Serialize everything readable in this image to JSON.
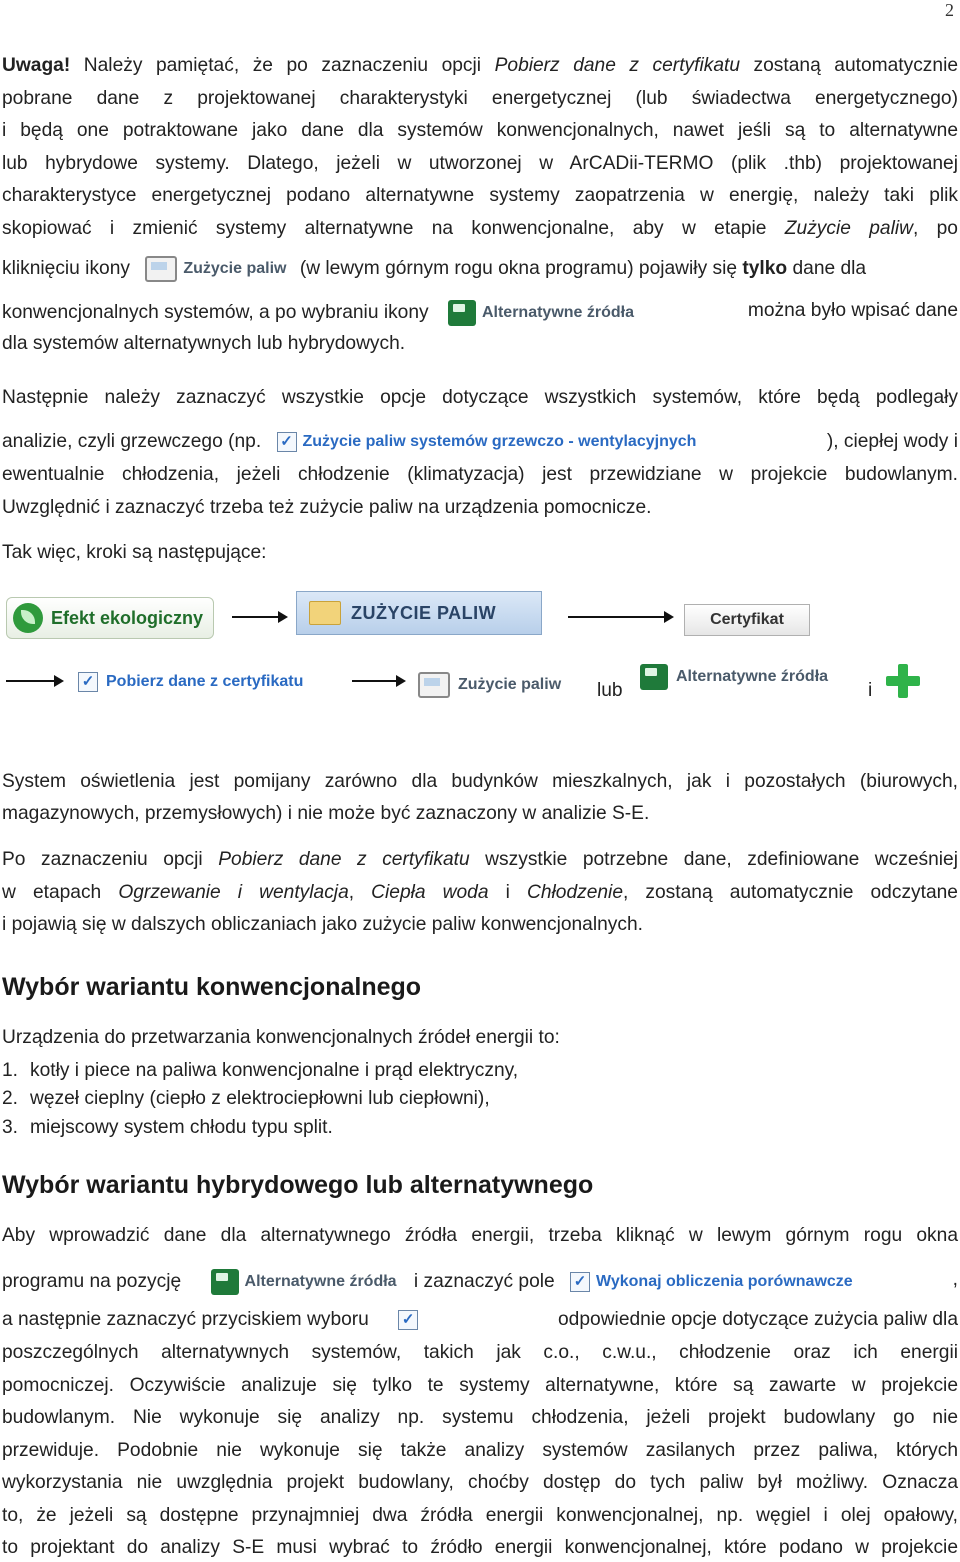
{
  "page_number": "2",
  "note": {
    "lead": "Uwaga!",
    "lines": [
      " Należy pamiętać, że po zaznaczeniu opcji ",
      "Pobierz dane z certyfikatu",
      " zostaną automatycznie"
    ],
    "l2": "pobrane dane z projektowanej charakterystyki energetycznej (lub świadectwa energetycznego)",
    "l3": "i będą one potraktowane jako dane dla systemów konwencjonalnych, nawet jeśli są to alternatywne",
    "l4": "lub hybrydowe systemy. Dlatego, jeżeli w utworzonej w ArCADii-TERMO (plik .thb) projektowanej",
    "l5": "charakterystyce energetycznej podano alternatywne systemy zaopatrzenia w energię, należy taki plik",
    "l6a": "skopiować i zmienić systemy alternatywne na konwencjonalne, aby w etapie ",
    "l6b": "Zużycie paliw",
    "l6c": ", po",
    "l7a": "kliknięciu ikony",
    "l7b": "(w lewym górnym rogu okna programu) pojawiły się ",
    "l7c": "tylko",
    "l7d": " dane dla",
    "l8a": "konwencjonalnych systemów, a po wybraniu ikony",
    "l8b": "można było wpisać dane",
    "l9": "dla systemów alternatywnych lub hybrydowych."
  },
  "ui_labels": {
    "zuzycie_paliw": "Zużycie paliw",
    "alternatywne_zrodla": "Alternatywne źródła",
    "zuzycie_paliw_systemow": "Zużycie paliw systemów grzewczo - wentylacyjnych",
    "efekt_ekologiczny": "Efekt ekologiczny",
    "zuzycie_paliw_caps": "ZUŻYCIE PALIW",
    "certyfikat": "Certyfikat",
    "pobierz_dane": "Pobierz dane z certyfikatu",
    "wykonaj_obliczenia": "Wykonaj obliczenia porównawcze"
  },
  "para2": {
    "l1": "Następnie należy zaznaczyć wszystkie opcje dotyczące wszystkich systemów, które będą podlegały",
    "l2a": "analizie, czyli grzewczego (np.",
    "l2b": "), ciepłej wody i",
    "l3": "ewentualnie chłodzenia, jeżeli chłodzenie (klimatyzacja) jest przewidziane w projekcie budowlanym.",
    "l4": "Uwzględnić i zaznaczyć trzeba też zużycie paliw na urządzenia pomocnicze."
  },
  "steps_intro": "Tak więc, kroki są następujące:",
  "steps_or": "lub",
  "steps_and": "i",
  "para3": {
    "l1": "System oświetlenia jest pomijany zarówno dla budynków mieszkalnych, jak i pozostałych (biurowych,",
    "l2": "magazynowych, przemysłowych) i nie może być zaznaczony w analizie S-E."
  },
  "para4": {
    "l1a": "Po zaznaczeniu opcji ",
    "l1b": "Pobierz dane z certyfikatu",
    "l1c": " wszystkie potrzebne dane, zdefiniowane wcześniej",
    "l2a": "w etapach ",
    "l2b": "Ogrzewanie i wentylacja",
    "l2c": ", ",
    "l2d": "Ciepła woda",
    "l2e": " i ",
    "l2f": "Chłodzenie",
    "l2g": ", zostaną automatycznie odczytane",
    "l3": "i pojawią się w dalszych obliczaniach jako zużycie paliw konwencjonalnych."
  },
  "heading1": "Wybór wariantu konwencjonalnego",
  "conv_intro": "Urządzenia do przetwarzania konwencjonalnych źródeł energii to:",
  "conv_list": [
    {
      "num": "1.",
      "text": "kotły i piece na paliwa konwencjonalne i prąd elektryczny,"
    },
    {
      "num": "2.",
      "text": "węzeł cieplny (ciepło z elektrociepłowni lub ciepłowni),"
    },
    {
      "num": "3.",
      "text": "miejscowy system chłodu typu split."
    }
  ],
  "heading2": "Wybór wariantu hybrydowego lub alternatywnego",
  "para5": {
    "l1": "Aby wprowadzić dane dla alternatywnego źródła energii, trzeba kliknąć w lewym górnym rogu okna",
    "l2a": "programu na pozycję",
    "l2b": "i zaznaczyć pole",
    "l2c": ",",
    "l3a": "a następnie zaznaczyć przyciskiem wyboru",
    "l3b": "odpowiednie opcje dotyczące zużycia paliw dla",
    "l4": "poszczególnych alternatywnych systemów, takich jak c.o., c.w.u., chłodzenie oraz ich energii",
    "l5": "pomocniczej. Oczywiście analizuje się tylko te systemy alternatywne, które są zawarte w projekcie",
    "l6": "budowlanym. Nie wykonuje się analizy np. systemu chłodzenia, jeżeli projekt budowlany go nie",
    "l7": "przewiduje. Podobnie nie wykonuje się także analizy systemów zasilanych przez paliwa, których",
    "l8": "wykorzystania nie uwzględnia projekt budowlany, choćby dostęp do tych paliw był możliwy. Oznacza",
    "l9": "to, że jeżeli są dostępne przynajmniej dwa źródła energii konwencjonalnej, np. węgiel i olej opałowy,",
    "l10": "to projektant do analizy S-E musi wybrać to źródło energii konwencjonalnej, które podano w projekcie"
  },
  "colors": {
    "accent_blue": "#2a6ac2",
    "eco_green": "#2f9a3c",
    "plus_green": "#2fb34a"
  }
}
